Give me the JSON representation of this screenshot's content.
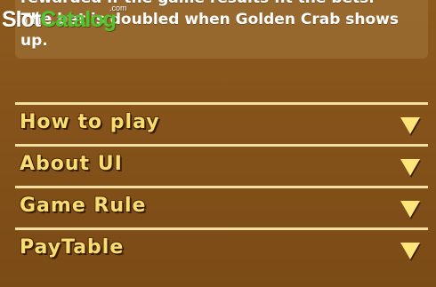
{
  "description": {
    "lines": [
      "rewarded if the game results fit the bets.",
      "The bet is doubled when Golden Crab shows",
      "up."
    ]
  },
  "watermark": {
    "part1": "Slot",
    "part2": "Catalog",
    "com": ".com"
  },
  "menu": {
    "items": [
      {
        "label": "How to play"
      },
      {
        "label": "About UI"
      },
      {
        "label": "Game Rule"
      },
      {
        "label": "PayTable"
      }
    ]
  },
  "colors": {
    "background": "#84521a",
    "label": "#f7dd72",
    "divider": "#f3dfa1",
    "arrow": "#ffe57a",
    "watermark_green": "#4fc72b"
  },
  "icons": {
    "expand": "triangle-down-icon"
  }
}
